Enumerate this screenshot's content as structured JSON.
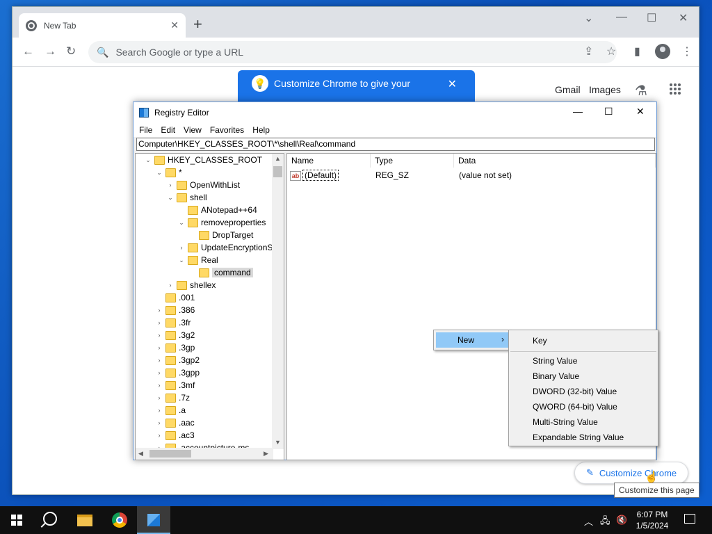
{
  "chrome": {
    "tab_title": "New Tab",
    "new_tab": "+",
    "omnibox_placeholder": "Search Google or type a URL",
    "promo_text": "Customize Chrome to give your",
    "gmail": "Gmail",
    "images": "Images",
    "customize_button": "Customize Chrome",
    "tooltip": "Customize this page"
  },
  "regedit": {
    "title": "Registry Editor",
    "menu": [
      "File",
      "Edit",
      "View",
      "Favorites",
      "Help"
    ],
    "address": "Computer\\HKEY_CLASSES_ROOT\\*\\shell\\Real\\command",
    "tree": [
      {
        "label": "HKEY_CLASSES_ROOT",
        "level": 0,
        "exp": "open"
      },
      {
        "label": "*",
        "level": 1,
        "exp": "open"
      },
      {
        "label": "OpenWithList",
        "level": 2,
        "exp": "closed"
      },
      {
        "label": "shell",
        "level": 2,
        "exp": "open"
      },
      {
        "label": "ANotepad++64",
        "level": 3,
        "exp": "none"
      },
      {
        "label": "removeproperties",
        "level": 3,
        "exp": "open"
      },
      {
        "label": "DropTarget",
        "level": 4,
        "exp": "none"
      },
      {
        "label": "UpdateEncryptionS",
        "level": 3,
        "exp": "closed"
      },
      {
        "label": "Real",
        "level": 3,
        "exp": "open"
      },
      {
        "label": "command",
        "level": 4,
        "exp": "none",
        "selected": true
      },
      {
        "label": "shellex",
        "level": 2,
        "exp": "closed"
      },
      {
        "label": ".001",
        "level": 1,
        "exp": "none"
      },
      {
        "label": ".386",
        "level": 1,
        "exp": "closed"
      },
      {
        "label": ".3fr",
        "level": 1,
        "exp": "closed"
      },
      {
        "label": ".3g2",
        "level": 1,
        "exp": "closed"
      },
      {
        "label": ".3gp",
        "level": 1,
        "exp": "closed"
      },
      {
        "label": ".3gp2",
        "level": 1,
        "exp": "closed"
      },
      {
        "label": ".3gpp",
        "level": 1,
        "exp": "closed"
      },
      {
        "label": ".3mf",
        "level": 1,
        "exp": "closed"
      },
      {
        "label": ".7z",
        "level": 1,
        "exp": "closed"
      },
      {
        "label": ".a",
        "level": 1,
        "exp": "closed"
      },
      {
        "label": ".aac",
        "level": 1,
        "exp": "closed"
      },
      {
        "label": ".ac3",
        "level": 1,
        "exp": "closed"
      },
      {
        "label": ".accountpicture-ms",
        "level": 1,
        "exp": "closed"
      }
    ],
    "columns": {
      "name": "Name",
      "type": "Type",
      "data": "Data"
    },
    "values": [
      {
        "name": "(Default)",
        "type": "REG_SZ",
        "data": "(value not set)"
      }
    ],
    "context_menu": {
      "new_label": "New",
      "submenu": [
        "Key",
        "String Value",
        "Binary Value",
        "DWORD (32-bit) Value",
        "QWORD (64-bit) Value",
        "Multi-String Value",
        "Expandable String Value"
      ]
    }
  },
  "taskbar": {
    "time": "6:07 PM",
    "date": "1/5/2024"
  },
  "icons": {
    "expanded": "⌄",
    "collapsed": "›"
  }
}
